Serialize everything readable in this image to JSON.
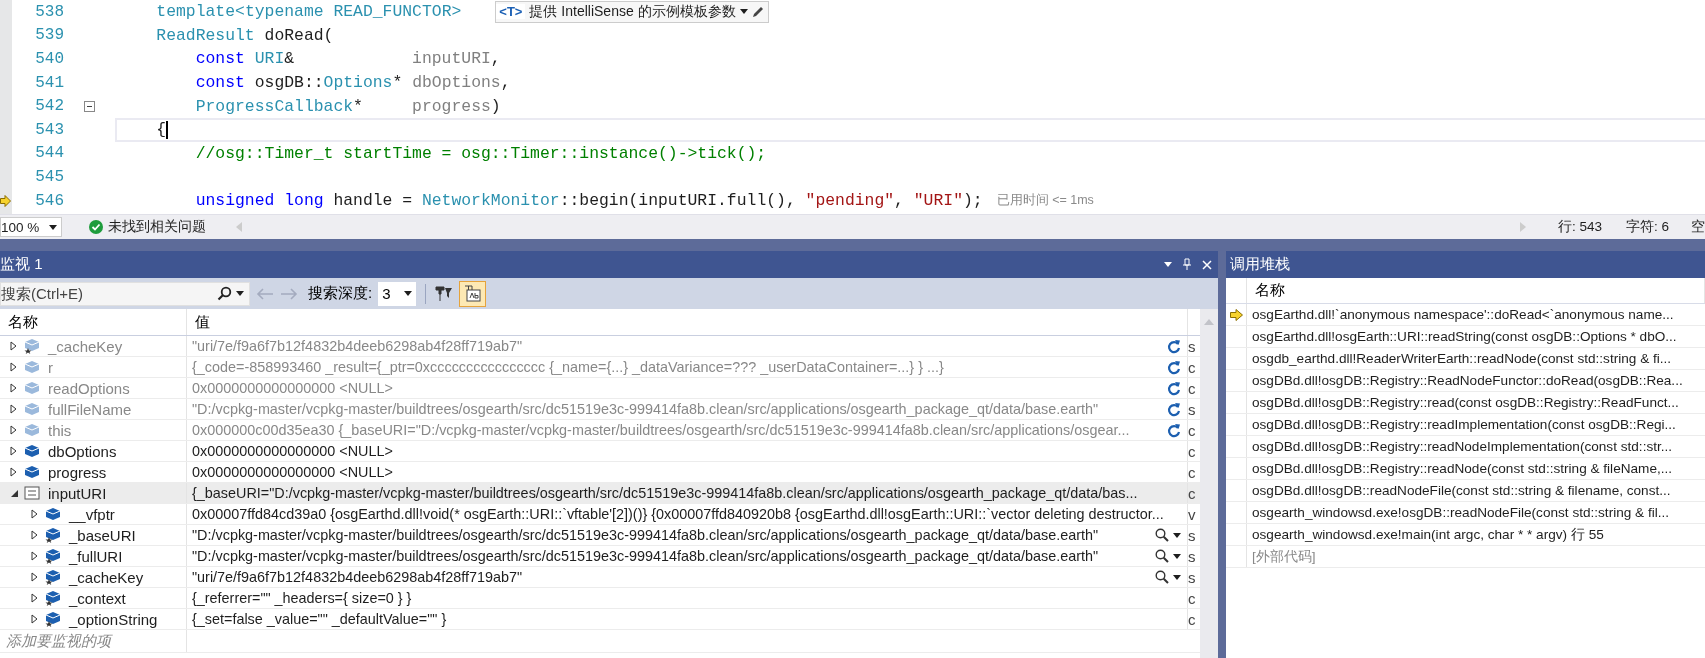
{
  "editor": {
    "lines": [
      {
        "number": "538",
        "tokens": [
          {
            "text": "    template",
            "kind": "type"
          },
          {
            "text": "<",
            "kind": "type"
          },
          {
            "text": "typename",
            "kind": "type"
          },
          {
            "text": " READ_FUNCTOR>",
            "kind": "type"
          }
        ],
        "annotation": {
          "kind": "template-hint",
          "tag": "<T>",
          "text": "提供 IntelliSense 的示例模板参数"
        }
      },
      {
        "number": "539",
        "tokens": [
          {
            "text": "    ReadResult",
            "kind": "type"
          },
          {
            "text": " doRead(",
            "kind": "plain"
          }
        ]
      },
      {
        "number": "540",
        "tokens": [
          {
            "text": "        const",
            "kind": "keyword"
          },
          {
            "text": " URI",
            "kind": "type"
          },
          {
            "text": "&            ",
            "kind": "plain"
          },
          {
            "text": "inputURI",
            "kind": "param"
          },
          {
            "text": ",",
            "kind": "plain"
          }
        ]
      },
      {
        "number": "541",
        "tokens": [
          {
            "text": "        const",
            "kind": "keyword"
          },
          {
            "text": " osgDB::",
            "kind": "plain"
          },
          {
            "text": "Options",
            "kind": "type"
          },
          {
            "text": "* ",
            "kind": "plain"
          },
          {
            "text": "dbOptions",
            "kind": "param"
          },
          {
            "text": ",",
            "kind": "plain"
          }
        ]
      },
      {
        "number": "542",
        "fold_toggle": true,
        "tokens": [
          {
            "text": "        ProgressCallback",
            "kind": "type"
          },
          {
            "text": "*     ",
            "kind": "plain"
          },
          {
            "text": "progress",
            "kind": "param"
          },
          {
            "text": ")",
            "kind": "plain"
          }
        ]
      },
      {
        "number": "543",
        "cursor": true,
        "tokens": [
          {
            "text": "    {",
            "kind": "plain"
          }
        ]
      },
      {
        "number": "544",
        "tokens": [
          {
            "text": "        //osg::Timer_t startTime = osg::Timer::instance()->tick();",
            "kind": "comment"
          }
        ]
      },
      {
        "number": "545"
      },
      {
        "number": "546",
        "current_statement": true,
        "tokens": [
          {
            "text": "        unsigned long",
            "kind": "keyword"
          },
          {
            "text": " handle = ",
            "kind": "plain"
          },
          {
            "text": "NetworkMonitor",
            "kind": "type"
          },
          {
            "text": "::begin(inputURI.full(), ",
            "kind": "plain"
          },
          {
            "text": "\"pending\"",
            "kind": "string"
          },
          {
            "text": ", ",
            "kind": "plain"
          },
          {
            "text": "\"URI\"",
            "kind": "string"
          },
          {
            "text": ");",
            "kind": "plain"
          }
        ],
        "annotation": {
          "kind": "perf-tip",
          "text": "已用时间 <= 1ms"
        }
      }
    ]
  },
  "editor_status": {
    "zoom": "100 %",
    "issues": "未找到相关问题",
    "line": "行: 543",
    "column": "字符: 6",
    "indent": "空"
  },
  "watch": {
    "title": "监视 1",
    "search": {
      "placeholder": "搜索(Ctrl+E)"
    },
    "depth_label": "搜索深度:",
    "depth": "3",
    "hex_toggle": {
      "on": true
    },
    "columns": [
      "名称",
      "值"
    ],
    "rows": [
      {
        "name": "_cacheKey",
        "kind": "member",
        "stale": true,
        "value": "\"uri/7e/f9a6f7b12f4832b4deeb6298ab4f28ff719ab7\"",
        "column_3": "s"
      },
      {
        "name": "r",
        "kind": "field",
        "stale": true,
        "value": "{_code=-858993460 _result={_ptr=0xcccccccccccccccc {_name={...} _dataVariance=??? _userDataContainer=...} } ...}",
        "column_3": "c"
      },
      {
        "name": "readOptions",
        "kind": "field",
        "stale": true,
        "value": "0x0000000000000000 <NULL>",
        "column_3": "c"
      },
      {
        "name": "fullFileName",
        "kind": "field",
        "stale": true,
        "value": "\"D:/vcpkg-master/vcpkg-master/buildtrees/osgearth/src/dc51519e3c-999414fa8b.clean/src/applications/osgearth_package_qt/data/base.earth\"",
        "column_3": "s"
      },
      {
        "name": "this",
        "kind": "field",
        "stale": true,
        "value": "0x000000c00d35ea30 {_baseURI=\"D:/vcpkg-master/vcpkg-master/buildtrees/osgearth/src/dc51519e3c-999414fa8b.clean/src/applications/osgear...",
        "column_3": "c"
      },
      {
        "name": "dbOptions",
        "kind": "field",
        "stale": false,
        "value": "0x0000000000000000 <NULL>",
        "column_3": "c"
      },
      {
        "name": "progress",
        "kind": "field",
        "stale": false,
        "value": "0x0000000000000000 <NULL>",
        "column_3": "c"
      },
      {
        "name": "inputURI",
        "kind": "object",
        "stale": false,
        "selected": true,
        "expanded": true,
        "value": "{_baseURI=\"D:/vcpkg-master/vcpkg-master/buildtrees/osgearth/src/dc51519e3c-999414fa8b.clean/src/applications/osgearth_package_qt/data/bas...",
        "column_3": "c",
        "children": [
          {
            "name": "__vfptr",
            "kind": "field",
            "stale": false,
            "value": "0x00007ffd84cd39a0 {osgEarthd.dll!void(* osgEarth::URI::`vftable'[2])()} {0x00007ffd840920b8 {osgEarthd.dll!osgEarth::URI::`vector deleting destructor...",
            "column_3": "v"
          },
          {
            "name": "_baseURI",
            "kind": "member",
            "stale": false,
            "visualizer": true,
            "value": "\"D:/vcpkg-master/vcpkg-master/buildtrees/osgearth/src/dc51519e3c-999414fa8b.clean/src/applications/osgearth_package_qt/data/base.earth\"",
            "column_3": "s"
          },
          {
            "name": "_fullURI",
            "kind": "member",
            "stale": false,
            "visualizer": true,
            "value": "\"D:/vcpkg-master/vcpkg-master/buildtrees/osgearth/src/dc51519e3c-999414fa8b.clean/src/applications/osgearth_package_qt/data/base.earth\"",
            "column_3": "s"
          },
          {
            "name": "_cacheKey",
            "kind": "member",
            "stale": false,
            "visualizer": true,
            "value": "\"uri/7e/f9a6f7b12f4832b4deeb6298ab4f28ff719ab7\"",
            "column_3": "s"
          },
          {
            "name": "_context",
            "kind": "member",
            "stale": false,
            "value": "{_referrer=\"\" _headers={ size=0 } }",
            "column_3": "c"
          },
          {
            "name": "_optionString",
            "kind": "member",
            "stale": false,
            "value": "{_set=false _value=\"\" _defaultValue=\"\" }",
            "column_3": "c"
          }
        ]
      }
    ],
    "add_placeholder": "添加要监视的项"
  },
  "call_stack": {
    "title": "调用堆栈",
    "column": "名称",
    "frames": [
      {
        "text": "osgEarthd.dll!`anonymous namespace'::doRead<`anonymous name...",
        "current": true,
        "kind": "code"
      },
      {
        "text": "osgEarthd.dll!osgEarth::URI::readString(const osgDB::Options * dbO...",
        "current": false,
        "kind": "code"
      },
      {
        "text": "osgdb_earthd.dll!ReaderWriterEarth::readNode(const std::string & fi...",
        "current": false,
        "kind": "code"
      },
      {
        "text": "osgDBd.dll!osgDB::Registry::ReadNodeFunctor::doRead(osgDB::Rea...",
        "current": false,
        "kind": "code"
      },
      {
        "text": "osgDBd.dll!osgDB::Registry::read(const osgDB::Registry::ReadFunct...",
        "current": false,
        "kind": "code"
      },
      {
        "text": "osgDBd.dll!osgDB::Registry::readImplementation(const osgDB::Regi...",
        "current": false,
        "kind": "code"
      },
      {
        "text": "osgDBd.dll!osgDB::Registry::readNodeImplementation(const std::str...",
        "current": false,
        "kind": "code"
      },
      {
        "text": "osgDBd.dll!osgDB::Registry::readNode(const std::string & fileName,...",
        "current": false,
        "kind": "code"
      },
      {
        "text": "osgDBd.dll!osgDB::readNodeFile(const std::string & filename, const...",
        "current": false,
        "kind": "code"
      },
      {
        "text": "osgearth_windowsd.exe!osgDB::readNodeFile(const std::string & fil...",
        "current": false,
        "kind": "code"
      },
      {
        "text": "osgearth_windowsd.exe!main(int argc, char * * argv) 行 55",
        "current": false,
        "kind": "code"
      },
      {
        "text": "[外部代码]",
        "current": false,
        "kind": "external"
      }
    ]
  }
}
